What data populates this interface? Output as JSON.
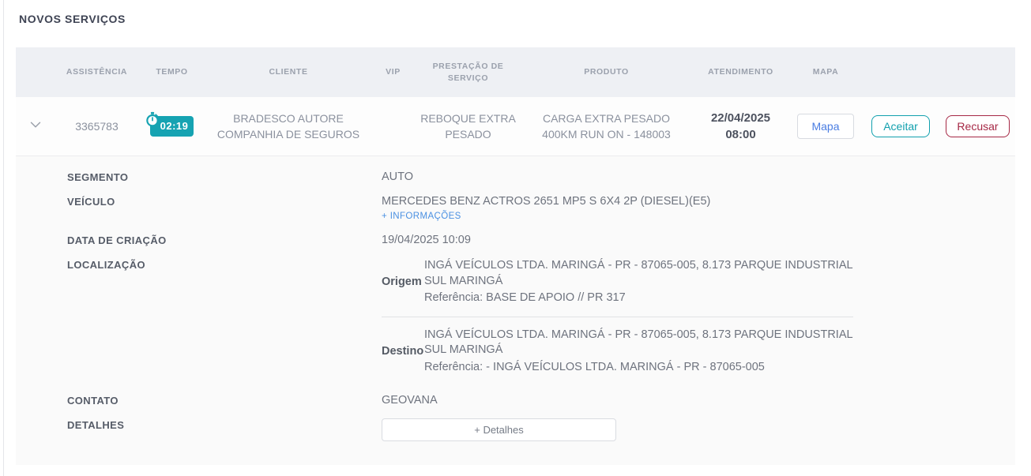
{
  "page": {
    "title": "NOVOS SERVIÇOS"
  },
  "colors": {
    "accent_teal": "#16a3b2",
    "accept_teal": "#12a0ae",
    "decline_red": "#a62845",
    "link_blue": "#4a90e2",
    "map_blue": "#4a7de2",
    "header_bg": "#eef0f4",
    "panel_bg": "#fafafa"
  },
  "table": {
    "columns": {
      "assistencia": "ASSISTÊNCIA",
      "tempo": "TEMPO",
      "cliente": "CLIENTE",
      "vip": "VIP",
      "prestacao": "PRESTAÇÃO DE SERVIÇO",
      "produto": "PRODUTO",
      "atendimento": "ATENDIMENTO",
      "mapa": "MAPA"
    },
    "row": {
      "assistencia": "3365783",
      "tempo": "02:19",
      "cliente_line1": "BRADESCO AUTORE",
      "cliente_line2": "COMPANHIA DE SEGUROS",
      "vip": "",
      "prestacao_line1": "REBOQUE EXTRA",
      "prestacao_line2": "PESADO",
      "produto_line1": "CARGA EXTRA PESADO",
      "produto_line2": "400KM RUN ON - 148003",
      "atendimento_date": "22/04/2025",
      "atendimento_time": "08:00",
      "mapa_button": "Mapa",
      "accept_button": "Aceitar",
      "decline_button": "Recusar"
    }
  },
  "details": {
    "segmento_label": "SEGMENTO",
    "segmento_value": "AUTO",
    "veiculo_label": "VEÍCULO",
    "veiculo_value": "MERCEDES BENZ ACTROS 2651 MP5 S 6X4 2P (DIESEL)(E5)",
    "mais_informacoes_link": "+ INFORMAÇÕES",
    "data_criacao_label": "DATA DE CRIAÇÃO",
    "data_criacao_value": "19/04/2025 10:09",
    "localizacao_label": "LOCALIZAÇÃO",
    "origem": {
      "label": "Origem",
      "address": "INGÁ VEÍCULOS LTDA. MARINGÁ - PR - 87065-005, 8.173 PARQUE INDUSTRIAL SUL MARINGÁ",
      "referencia": "Referência: BASE DE APOIO // PR 317"
    },
    "destino": {
      "label": "Destino",
      "address": "INGÁ VEÍCULOS LTDA. MARINGÁ - PR - 87065-005, 8.173 PARQUE INDUSTRIAL SUL MARINGÁ",
      "referencia": "Referência: - INGÁ VEÍCULOS LTDA. MARINGÁ - PR - 87065-005"
    },
    "contato_label": "CONTATO",
    "contato_value": "GEOVANA",
    "detalhes_label": "DETALHES",
    "detalhes_button": "+ Detalhes"
  }
}
